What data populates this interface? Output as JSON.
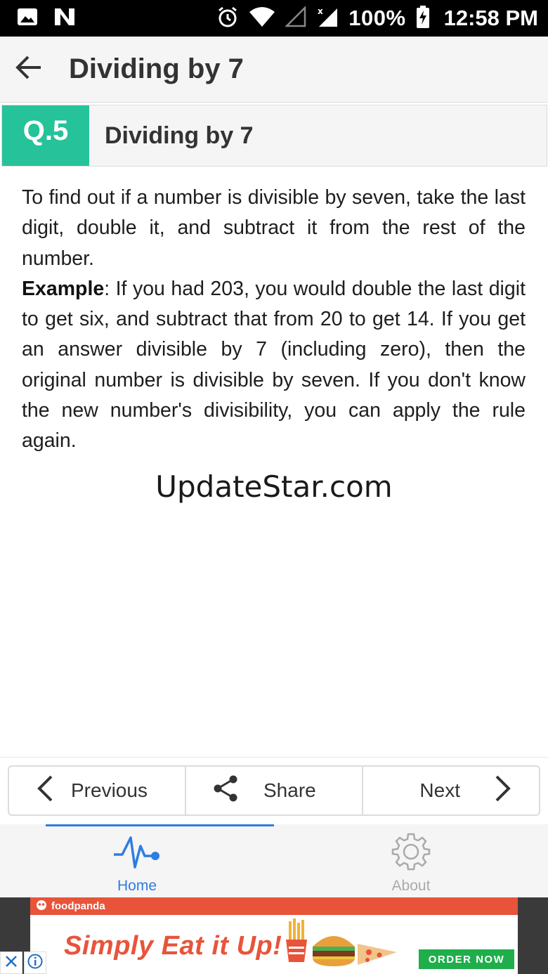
{
  "status_bar": {
    "battery": "100%",
    "time": "12:58 PM"
  },
  "app_bar": {
    "title": "Dividing by 7",
    "back_icon": "arrow-left-icon"
  },
  "question": {
    "number": "Q.5",
    "title": "Dividing by 7"
  },
  "content": {
    "paragraph1": "To find out if a number is divisible by seven, take the last digit, double it, and subtract it from the rest of the number.",
    "example_label": "Example",
    "example_text": ": If you had 203, you would double the last digit to get six, and subtract that from 20 to get 14. If you get an answer divisible by 7 (including zero), then the original number is divisible by seven. If you don't know the new number's divisibility, you can apply the rule again."
  },
  "watermark": "UpdateStar.com",
  "nav": {
    "previous": "Previous",
    "share": "Share",
    "next": "Next"
  },
  "tabs": [
    {
      "label": "Home",
      "icon": "heartbeat-icon",
      "active": true
    },
    {
      "label": "About",
      "icon": "gear-icon",
      "active": false
    }
  ],
  "ad": {
    "brand": "foodpanda",
    "slogan": "Simply  Eat it Up!",
    "cta": "ORDER NOW"
  },
  "colors": {
    "accent_green": "#26c29a",
    "tab_blue": "#2d7de3",
    "ad_orange": "#e8543a",
    "ad_green": "#1fae4b"
  }
}
